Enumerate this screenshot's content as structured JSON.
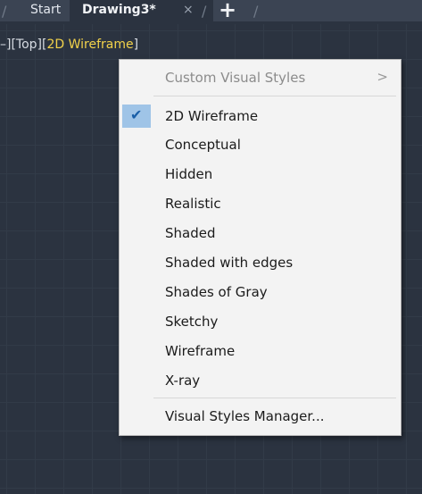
{
  "tabs": {
    "start_label": "Start",
    "active_label": "Drawing3*",
    "close_glyph": "×",
    "add_glyph": "+",
    "separator_glyph": "/"
  },
  "viewport": {
    "prefix": "–][Top][",
    "active_style": "2D Wireframe",
    "suffix": "]"
  },
  "menu": {
    "header": "Custom Visual Styles",
    "submenu_arrow": ">",
    "checked_icon": "checkmark-icon",
    "checkmark_glyph": "✔",
    "items": [
      {
        "label": "2D Wireframe",
        "checked": true
      },
      {
        "label": "Conceptual"
      },
      {
        "label": "Hidden"
      },
      {
        "label": "Realistic"
      },
      {
        "label": "Shaded"
      },
      {
        "label": "Shaded with edges"
      },
      {
        "label": "Shades of Gray"
      },
      {
        "label": "Sketchy"
      },
      {
        "label": "Wireframe"
      },
      {
        "label": "X-ray"
      }
    ],
    "footer": "Visual Styles Manager..."
  },
  "colors": {
    "canvas_bg": "#2b3340",
    "accent_yellow": "#f2d24a",
    "menu_bg": "#f3f3f3",
    "check_highlight": "#9fc4e7"
  }
}
